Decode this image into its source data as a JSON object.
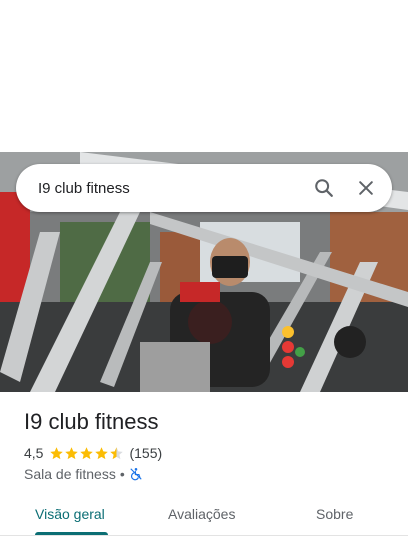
{
  "search": {
    "query": "I9 club fitness"
  },
  "place": {
    "name": "I9 club fitness",
    "rating": "4,5",
    "rating_fraction": 0.9,
    "review_count": "(155)",
    "category": "Sala de fitness",
    "separator": "•",
    "accessibility_icon": "wheelchair-not-accessible-icon"
  },
  "tabs": [
    {
      "label": "Visão geral",
      "active": true
    },
    {
      "label": "Avaliações",
      "active": false
    },
    {
      "label": "Sobre",
      "active": false
    }
  ],
  "colors": {
    "accent": "#0b6e74",
    "star": "#fbbc04",
    "accessibility_icon": "#1a73e8"
  }
}
